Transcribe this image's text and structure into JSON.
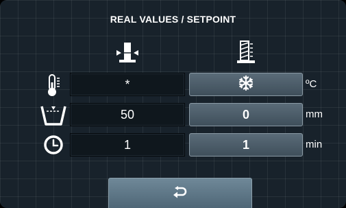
{
  "title": "REAL VALUES / SETPOINT",
  "columns": {
    "real_icon": "actual-gauge-icon",
    "setpoint_icon": "setpoint-gauge-icon"
  },
  "rows": [
    {
      "icon": "thermometer-icon",
      "real": "*",
      "setpoint_icon": "snowflake-icon",
      "unit": "ºC"
    },
    {
      "icon": "water-level-icon",
      "real": "50",
      "setpoint": "0",
      "unit": "mm"
    },
    {
      "icon": "clock-icon",
      "real": "1",
      "setpoint": "1",
      "unit": "min"
    }
  ],
  "footer": {
    "back_icon": "back-arrow-icon"
  },
  "colors": {
    "background": "#18222b",
    "real_cell": "#0f171d",
    "setpoint_button": "#4e5f6c",
    "back_button": "#5e7787"
  }
}
